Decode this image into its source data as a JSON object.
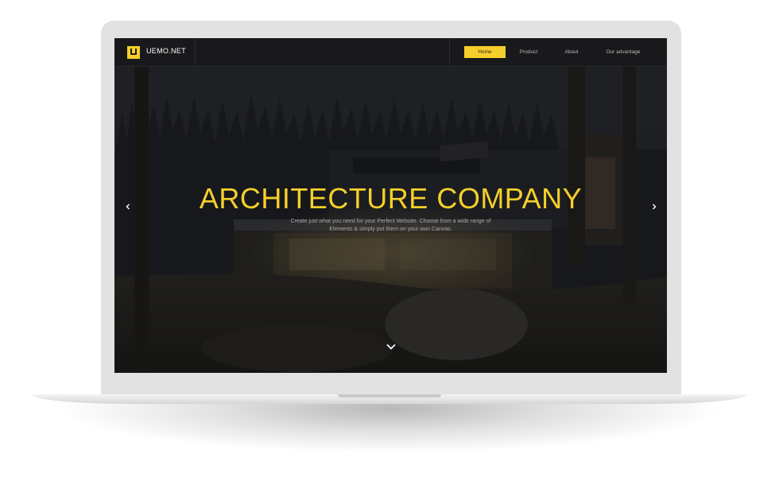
{
  "site": {
    "brand": "UEMO.NET",
    "logo_icon": "u-logo-icon"
  },
  "nav": {
    "items": [
      {
        "label": "Home",
        "active": true
      },
      {
        "label": "Product",
        "active": false
      },
      {
        "label": "About",
        "active": false
      },
      {
        "label": "Our advantage",
        "active": false
      }
    ]
  },
  "hero": {
    "title": "ARCHITECTURE COMPANY",
    "subtitle": "Create just what you need for your Perfect Website. Choose from a wide range of Elements & simply put them on your own Canvas.",
    "prev_icon": "chevron-left-icon",
    "next_icon": "chevron-right-icon",
    "scroll_icon": "chevron-down-icon"
  },
  "colors": {
    "accent": "#f5cf2b",
    "background": "#1c1d20",
    "device": "#e2e2e2"
  }
}
